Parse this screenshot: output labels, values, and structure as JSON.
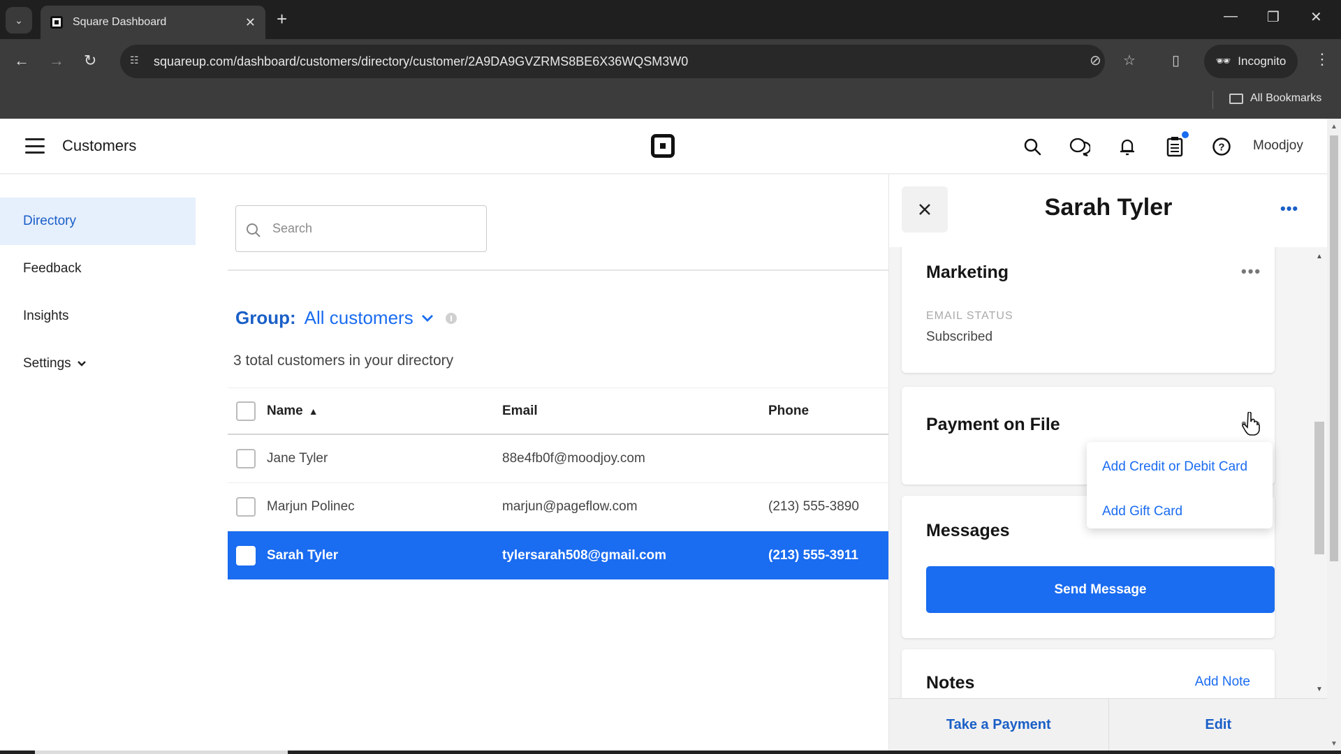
{
  "browser": {
    "tab_title": "Square Dashboard",
    "url": "squareup.com/dashboard/customers/directory/customer/2A9DA9GVZRMS8BE6X36WQSM3W0",
    "incognito_label": "Incognito",
    "bookmarks_label": "All Bookmarks",
    "icons": [
      "tab-search-icon",
      "close-icon",
      "new-tab-icon",
      "minimize-icon",
      "restore-icon",
      "window-close-icon",
      "back-icon",
      "forward-icon",
      "reload-icon",
      "site-info-icon",
      "eye-off-icon",
      "star-icon",
      "side-panel-icon",
      "incognito-icon",
      "menu-icon",
      "folder-icon"
    ]
  },
  "header": {
    "title": "Customers",
    "user": "Moodjoy",
    "icons": [
      "hamburger-icon",
      "square-logo",
      "search-icon",
      "chat-icon",
      "bell-icon",
      "clipboard-icon",
      "help-icon"
    ],
    "notification_dot_color": "#1a6cf0"
  },
  "sidebar": {
    "items": [
      {
        "label": "Directory",
        "active": true
      },
      {
        "label": "Feedback",
        "active": false
      },
      {
        "label": "Insights",
        "active": false
      },
      {
        "label": "Settings",
        "active": false,
        "has_chevron": true
      }
    ]
  },
  "main": {
    "search_placeholder": "Search",
    "group_label": "Group:",
    "group_value": "All customers",
    "total_text": "3 total customers in your directory",
    "table": {
      "columns": [
        "Name",
        "Email",
        "Phone"
      ],
      "sort_column": "Name",
      "sort_dir": "ascending",
      "rows": [
        {
          "name": "Jane Tyler",
          "email": "88e4fb0f@moodjoy.com",
          "phone": "",
          "selected": false
        },
        {
          "name": "Marjun Polinec",
          "email": "marjun@pageflow.com",
          "phone": "(213) 555-3890",
          "selected": false
        },
        {
          "name": "Sarah Tyler",
          "email": "tylersarah508@gmail.com",
          "phone": "(213) 555-3911",
          "selected": true
        }
      ]
    }
  },
  "panel": {
    "title": "Sarah Tyler",
    "more_label": "•••",
    "marketing": {
      "title": "Marketing",
      "dots": "•••",
      "email_status_label": "EMAIL STATUS",
      "email_status_value": "Subscribed"
    },
    "payment": {
      "title": "Payment on File",
      "menu": [
        "Add Credit or Debit Card",
        "Add Gift Card"
      ]
    },
    "messages": {
      "title": "Messages",
      "send_label": "Send Message"
    },
    "notes": {
      "title": "Notes",
      "add_label": "Add Note"
    },
    "footer": {
      "take_payment": "Take a Payment",
      "edit": "Edit"
    }
  },
  "colors": {
    "accent": "#1a6cf0",
    "sidebar_active_bg": "#e6effc",
    "selected_row": "#1a6cf0"
  }
}
